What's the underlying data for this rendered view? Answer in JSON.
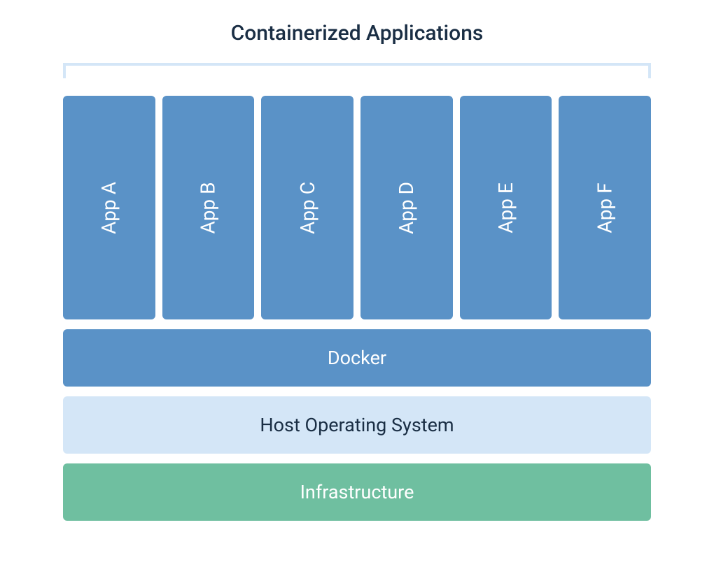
{
  "title": "Containerized Applications",
  "apps": {
    "0": {
      "label": "App A"
    },
    "1": {
      "label": "App B"
    },
    "2": {
      "label": "App C"
    },
    "3": {
      "label": "App D"
    },
    "4": {
      "label": "App E"
    },
    "5": {
      "label": "App F"
    }
  },
  "layers": {
    "docker": "Docker",
    "host_os": "Host Operating System",
    "infrastructure": "Infrastructure"
  },
  "colors": {
    "app_box": "#5a92c7",
    "docker": "#5a92c7",
    "host_os_bg": "#d4e6f7",
    "host_os_text": "#1a2e44",
    "infrastructure": "#6fbfa0",
    "title_text": "#1a2e44",
    "bracket": "#d4e6f7"
  }
}
